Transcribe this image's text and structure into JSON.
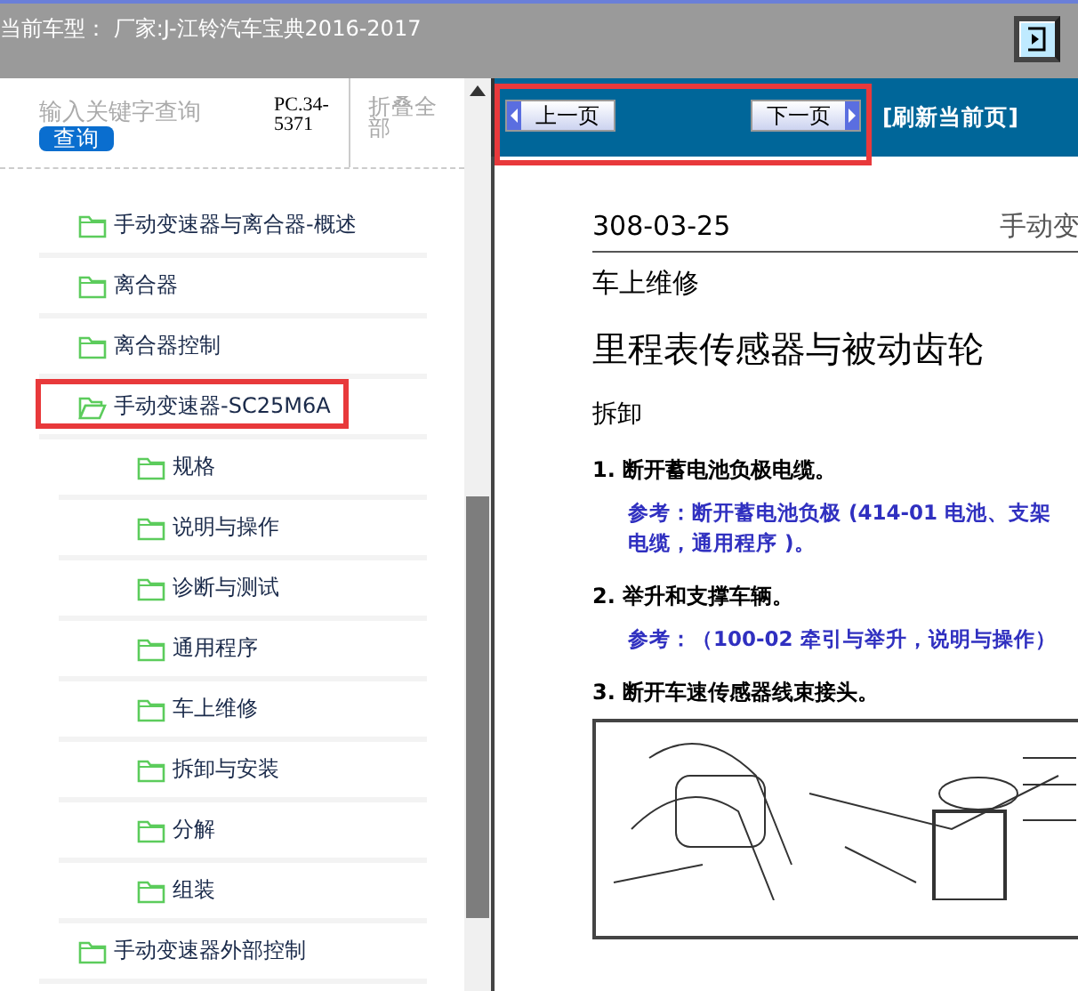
{
  "header": {
    "title": "当前车型： 厂家:J-江铃汽车宝典2016-2017"
  },
  "search": {
    "placeholder": "输入关键字查询",
    "button": "查询",
    "code": "PC.34-5371",
    "collapse": "折叠全部"
  },
  "tree": [
    {
      "label": "手动变速器与离合器-概述",
      "expanded": false,
      "annotated": false
    },
    {
      "label": "离合器",
      "expanded": false,
      "annotated": false
    },
    {
      "label": "离合器控制",
      "expanded": false,
      "annotated": false
    },
    {
      "label": "手动变速器-SC25M6A",
      "expanded": true,
      "annotated": true,
      "children": [
        {
          "label": "规格",
          "expanded": false
        },
        {
          "label": "说明与操作",
          "expanded": false
        },
        {
          "label": "诊断与测试",
          "expanded": false
        },
        {
          "label": "通用程序",
          "expanded": false
        },
        {
          "label": "车上维修",
          "expanded": false
        },
        {
          "label": "拆卸与安装",
          "expanded": false
        },
        {
          "label": "分解",
          "expanded": false
        },
        {
          "label": "组装",
          "expanded": false
        }
      ]
    },
    {
      "label": "手动变速器外部控制",
      "expanded": false,
      "annotated": false
    }
  ],
  "nav": {
    "annotated": true,
    "prev": "上一页",
    "next": "下一页",
    "refresh": "[刷新当前页]"
  },
  "document": {
    "page_number": "308-03-25",
    "page_title": "手动变",
    "section": "车上维修",
    "heading": "里程表传感器与被动齿轮",
    "subheading": "拆卸",
    "steps": [
      {
        "kind": "step",
        "text": "1. 断开蓄电池负极电缆。"
      },
      {
        "kind": "note",
        "text": "参考：断开蓄电池负极 (414-01 电池、支架"
      },
      {
        "kind": "note",
        "text": "电缆，通用程序 )。"
      },
      {
        "kind": "step",
        "text": "2. 举升和支撑车辆。"
      },
      {
        "kind": "note",
        "text": "参考：（100-02 牵引与举升，说明与操作）"
      },
      {
        "kind": "step",
        "text": "3. 断开车速传感器线束接头。"
      }
    ]
  }
}
